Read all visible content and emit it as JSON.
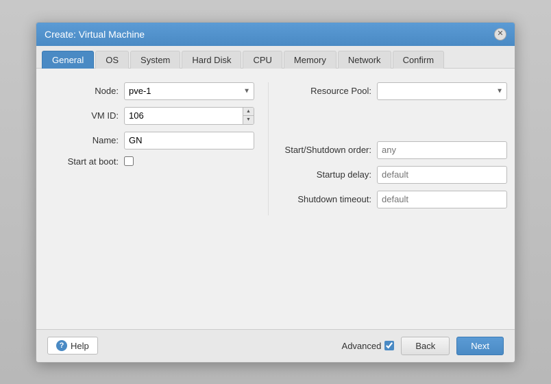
{
  "dialog": {
    "title": "Create: Virtual Machine",
    "close_label": "×"
  },
  "tabs": [
    {
      "label": "General",
      "active": true
    },
    {
      "label": "OS"
    },
    {
      "label": "System"
    },
    {
      "label": "Hard Disk"
    },
    {
      "label": "CPU"
    },
    {
      "label": "Memory"
    },
    {
      "label": "Network"
    },
    {
      "label": "Confirm"
    }
  ],
  "form": {
    "node_label": "Node:",
    "node_value": "pve-1",
    "resource_pool_label": "Resource Pool:",
    "resource_pool_placeholder": "",
    "vm_id_label": "VM ID:",
    "vm_id_value": "106",
    "name_label": "Name:",
    "name_value": "GN",
    "start_at_boot_label": "Start at boot:",
    "start_shutdown_label": "Start/Shutdown order:",
    "start_shutdown_placeholder": "any",
    "startup_delay_label": "Startup delay:",
    "startup_delay_placeholder": "default",
    "shutdown_timeout_label": "Shutdown timeout:",
    "shutdown_timeout_placeholder": "default"
  },
  "footer": {
    "help_label": "Help",
    "advanced_label": "Advanced",
    "back_label": "Back",
    "next_label": "Next"
  }
}
